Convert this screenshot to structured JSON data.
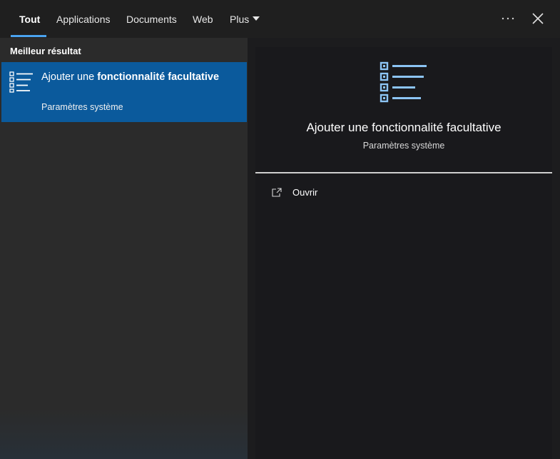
{
  "tabs": [
    {
      "label": "Tout",
      "active": true
    },
    {
      "label": "Applications"
    },
    {
      "label": "Documents"
    },
    {
      "label": "Web"
    },
    {
      "label": "Plus"
    }
  ],
  "header_icons": [
    "more-options-icon",
    "close-icon"
  ],
  "best_result": {
    "section_label": "Meilleur résultat",
    "title_prefix": "Ajouter une ",
    "title_bold": "fonctionnalité facultative",
    "subtitle": "Paramètres système",
    "icon": "checklist-icon"
  },
  "preview": {
    "icon": "checklist-icon",
    "title": "Ajouter une fonctionnalité facultative",
    "subtitle": "Paramètres système",
    "actions": [
      {
        "label": "Ouvrir",
        "icon": "open-icon"
      }
    ]
  },
  "colors": {
    "accent": "#4aa3ef",
    "selection": "#0b5a9c",
    "icon_blue": "#8cc4f4"
  }
}
